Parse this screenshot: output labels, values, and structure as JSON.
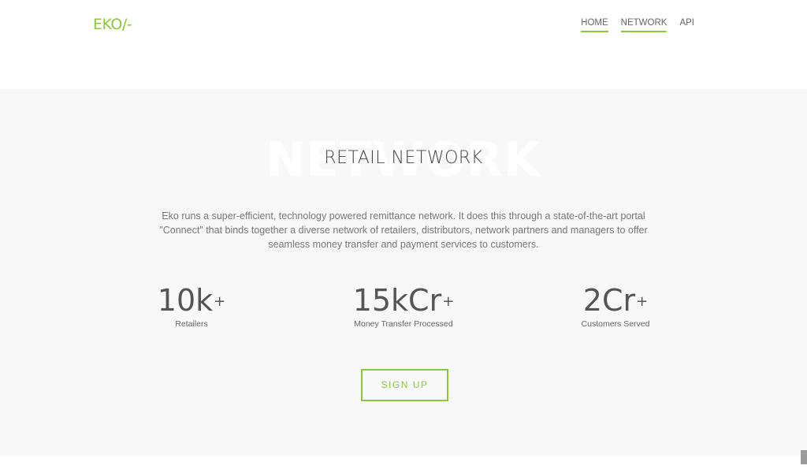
{
  "header": {
    "logo": "EKO/-",
    "nav": [
      {
        "label": "HOME"
      },
      {
        "label": "NETWORK"
      },
      {
        "label": "API"
      }
    ]
  },
  "network": {
    "watermark": "NETWORK",
    "title": "RETAIL NETWORK",
    "description": "Eko runs a super-efficient, technology powered remittance network. It does this through a state-of-the-art portal \"Connect\" that binds together a diverse network of retailers, distributors, network partners and managers to offer seamless money transfer and payment services to customers.",
    "stats": [
      {
        "value": "10k",
        "suffix": "+",
        "label": "Retailers"
      },
      {
        "value": "15kCr",
        "suffix": "+",
        "label": "Money Transfer Processed"
      },
      {
        "value": "2Cr",
        "suffix": "+",
        "label": "Customers Served"
      }
    ],
    "signup_label": "SIGN UP"
  },
  "colors": {
    "accent": "#8dc63f",
    "section_bg": "#f8f8f8",
    "text": "#555555"
  }
}
